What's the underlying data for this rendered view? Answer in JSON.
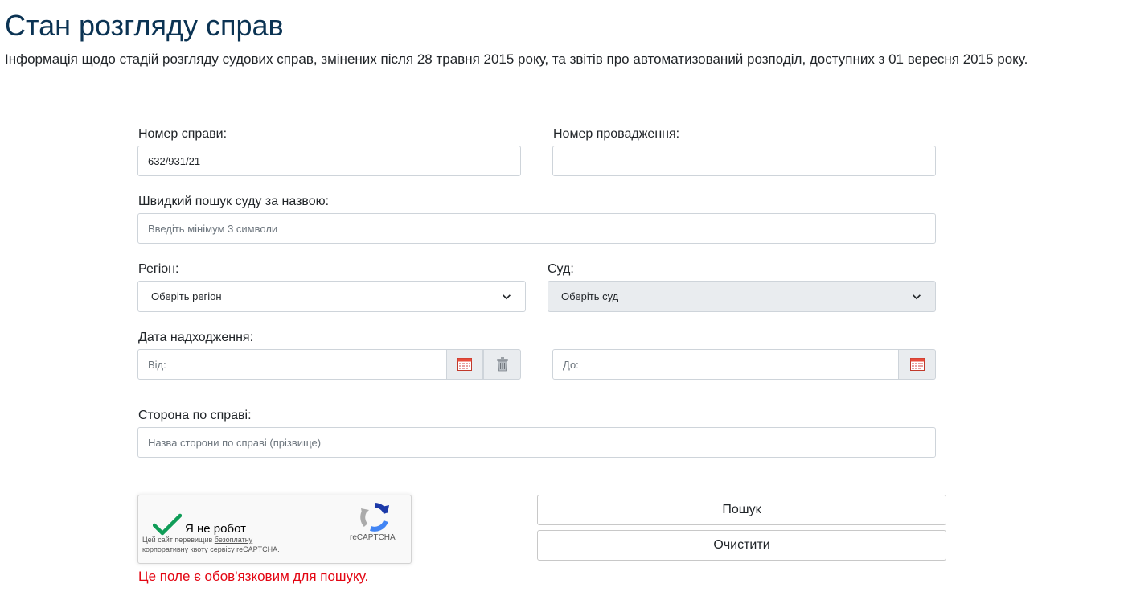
{
  "header": {
    "title": "Стан розгляду справ",
    "description": "Інформація щодо стадій розгляду судових справ, змінених після 28 травня 2015 року, та звітів про автоматизований розподіл, доступних з 01 вересня 2015 року."
  },
  "form": {
    "case_number": {
      "label": "Номер справи:",
      "value": "632/931/21"
    },
    "proceeding_number": {
      "label": "Номер провадження:",
      "value": ""
    },
    "court_search": {
      "label": "Швидкий пошук суду за назвою:",
      "placeholder": "Введіть мінімум 3 символи"
    },
    "region": {
      "label": "Регіон:",
      "selected": "Оберіть регіон"
    },
    "court": {
      "label": "Суд:",
      "selected": "Оберіть суд"
    },
    "receipt_date": {
      "label": "Дата надходження:",
      "from_placeholder": "Від:",
      "to_placeholder": "До:"
    },
    "party": {
      "label": "Сторона по справі:",
      "placeholder": "Назва сторони по справі (прізвище)"
    }
  },
  "recaptcha": {
    "label": "Я не робот",
    "note_prefix": "Цей сайт перевищив ",
    "note_link": "безоплатну корпоративну квоту сервісу reCAPTCHA",
    "note_suffix": ".",
    "brand": "reCAPTCHA"
  },
  "buttons": {
    "search": "Пошук",
    "clear": "Очистити"
  },
  "error": "Це поле є обов'язковим для пошуку.",
  "colors": {
    "title": "#0b3353",
    "error": "#e30613",
    "check": "#109d58",
    "border": "#ced4da"
  },
  "icons": {
    "calendar": "calendar-icon",
    "trash": "trash-icon",
    "chevron": "chevron-down-icon"
  }
}
